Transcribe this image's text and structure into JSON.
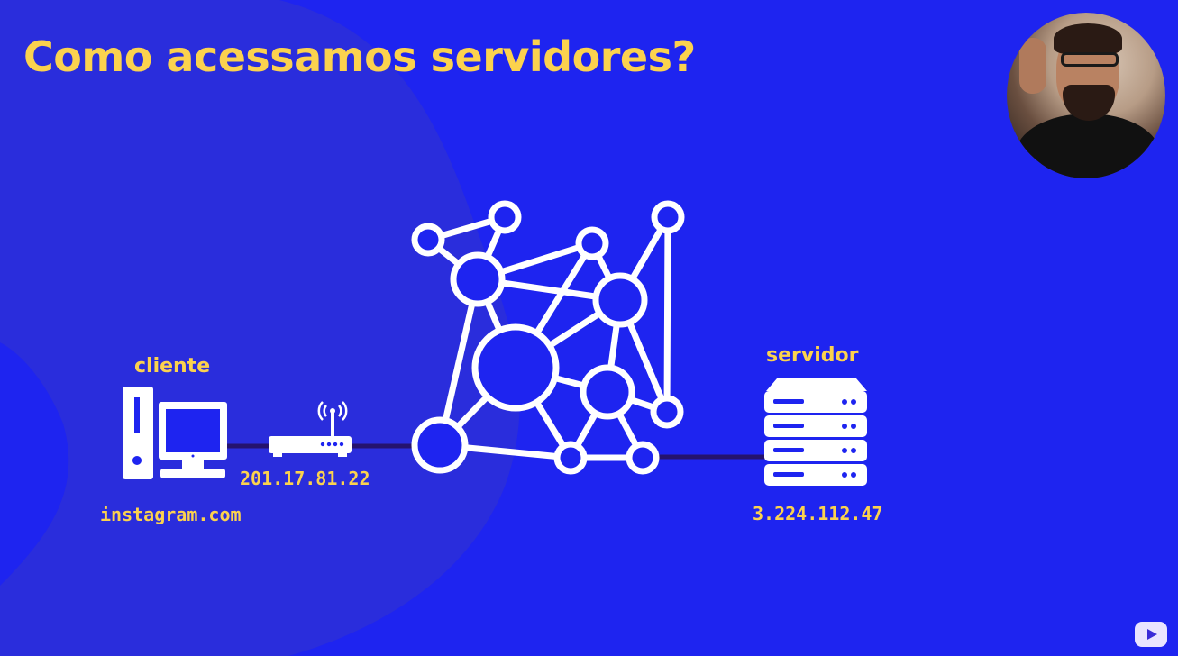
{
  "title": "Como acessamos servidores?",
  "client": {
    "label": "cliente",
    "domain": "instagram.com",
    "router_ip": "201.17.81.22"
  },
  "server": {
    "label": "servidor",
    "ip": "3.224.112.47"
  },
  "colors": {
    "background": "#1e24f0",
    "blob": "#2a2ddc",
    "accent": "#fbd24e",
    "icons": "#ffffff",
    "connection_line": "#25136e"
  }
}
